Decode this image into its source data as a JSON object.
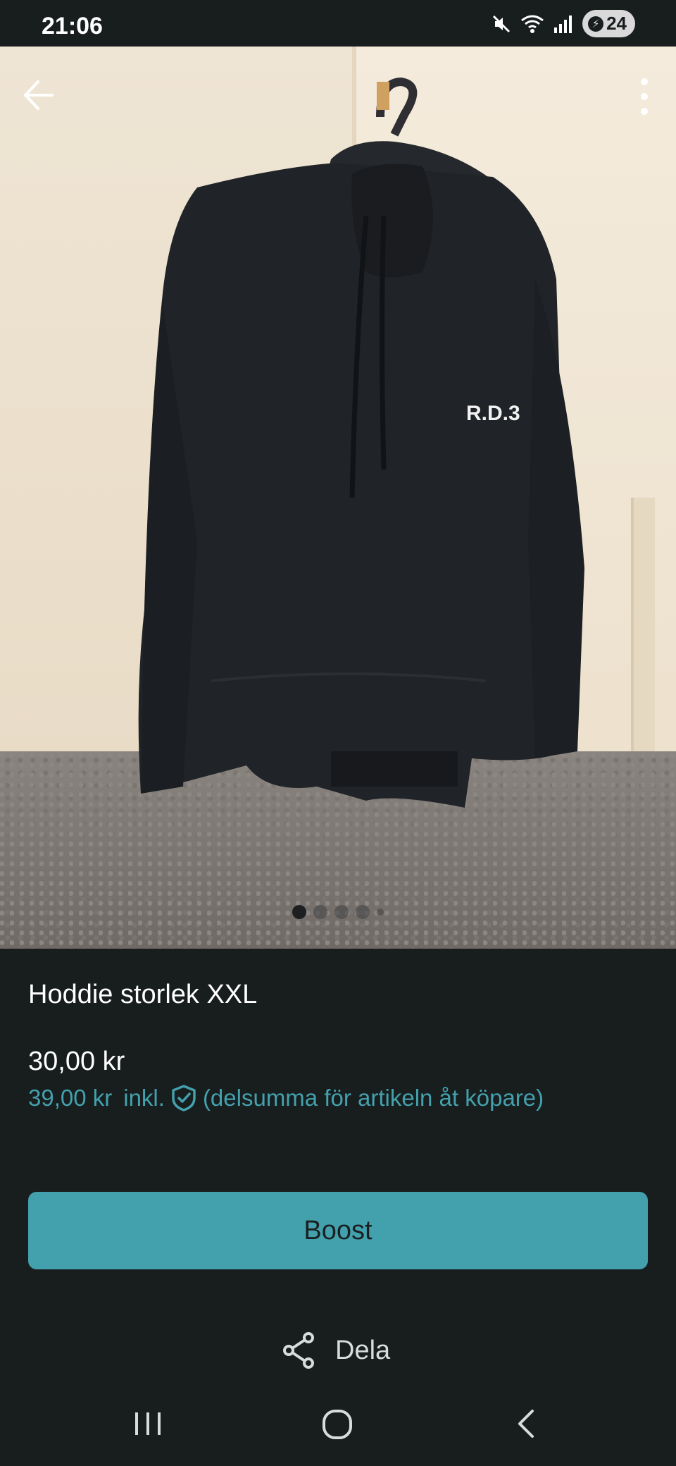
{
  "status_bar": {
    "time": "21:06",
    "battery": "24"
  },
  "carousel": {
    "total": 5,
    "active_index": 0
  },
  "item": {
    "title": "Hoddie storlek XXL",
    "price": "30,00 kr",
    "price_incl": "39,00 kr",
    "incl_label": "inkl.",
    "incl_note": "(delsumma för artikeln åt köpare)"
  },
  "actions": {
    "boost_label": "Boost",
    "share_label": "Dela"
  },
  "photo": {
    "print_text": "R.D.3"
  },
  "colors": {
    "background": "#181d1e",
    "accent": "#43a1ad"
  },
  "icons": {
    "back": "arrow-left-icon",
    "menu": "more-vertical-icon",
    "buyer_protection": "shield-check-icon",
    "share": "share-icon"
  }
}
